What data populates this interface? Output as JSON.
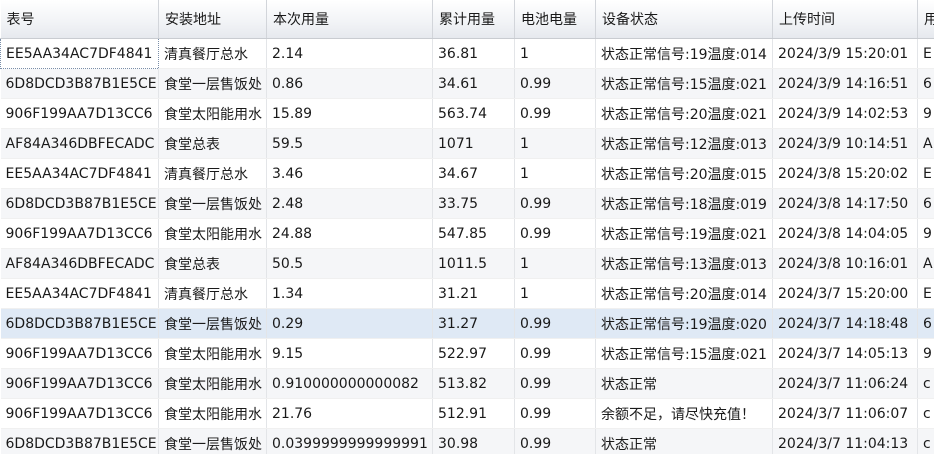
{
  "table": {
    "columns": [
      "表号",
      "安装地址",
      "本次用量",
      "累计用量",
      "电池电量",
      "设备状态",
      "上传时间",
      "用"
    ],
    "rows": [
      [
        "EE5AA34AC7DF4841",
        "清真餐厅总水",
        "2.14",
        "36.81",
        "1",
        "状态正常信号:19温度:014",
        "2024/3/9 15:20:01",
        "E"
      ],
      [
        "6D8DCD3B87B1E5CE",
        "食堂一层售饭处",
        "0.86",
        "34.61",
        "0.99",
        "状态正常信号:15温度:021",
        "2024/3/9 14:16:51",
        "6"
      ],
      [
        "906F199AA7D13CC6",
        "食堂太阳能用水",
        "15.89",
        "563.74",
        "0.99",
        "状态正常信号:20温度:021",
        "2024/3/9 14:02:53",
        "9"
      ],
      [
        "AF84A346DBFECADC",
        "食堂总表",
        "59.5",
        "1071",
        "1",
        "状态正常信号:12温度:013",
        "2024/3/9 10:14:51",
        "A"
      ],
      [
        "EE5AA34AC7DF4841",
        "清真餐厅总水",
        "3.46",
        "34.67",
        "1",
        "状态正常信号:20温度:015",
        "2024/3/8 15:20:02",
        "E"
      ],
      [
        "6D8DCD3B87B1E5CE",
        "食堂一层售饭处",
        "2.48",
        "33.75",
        "0.99",
        "状态正常信号:18温度:019",
        "2024/3/8 14:17:50",
        "6"
      ],
      [
        "906F199AA7D13CC6",
        "食堂太阳能用水",
        "24.88",
        "547.85",
        "0.99",
        "状态正常信号:19温度:021",
        "2024/3/8 14:04:05",
        "9"
      ],
      [
        "AF84A346DBFECADC",
        "食堂总表",
        "50.5",
        "1011.5",
        "1",
        "状态正常信号:13温度:013",
        "2024/3/8 10:16:01",
        "A"
      ],
      [
        "EE5AA34AC7DF4841",
        "清真餐厅总水",
        "1.34",
        "31.21",
        "1",
        "状态正常信号:20温度:014",
        "2024/3/7 15:20:00",
        "E"
      ],
      [
        "6D8DCD3B87B1E5CE",
        "食堂一层售饭处",
        "0.29",
        "31.27",
        "0.99",
        "状态正常信号:19温度:020",
        "2024/3/7 14:18:48",
        "6"
      ],
      [
        "906F199AA7D13CC6",
        "食堂太阳能用水",
        "9.15",
        "522.97",
        "0.99",
        "状态正常信号:15温度:021",
        "2024/3/7 14:05:13",
        "9"
      ],
      [
        "906F199AA7D13CC6",
        "食堂太阳能用水",
        "0.910000000000082",
        "513.82",
        "0.99",
        "状态正常",
        "2024/3/7 11:06:24",
        "c"
      ],
      [
        "906F199AA7D13CC6",
        "食堂太阳能用水",
        "21.76",
        "512.91",
        "0.99",
        "余额不足，请尽快充值！",
        "2024/3/7 11:06:07",
        "c"
      ],
      [
        "6D8DCD3B87B1E5CE",
        "食堂一层售饭处",
        "0.0399999999999991",
        "30.98",
        "0.99",
        "状态正常",
        "2024/3/7 11:04:13",
        "c"
      ]
    ],
    "selected_row": 9
  }
}
